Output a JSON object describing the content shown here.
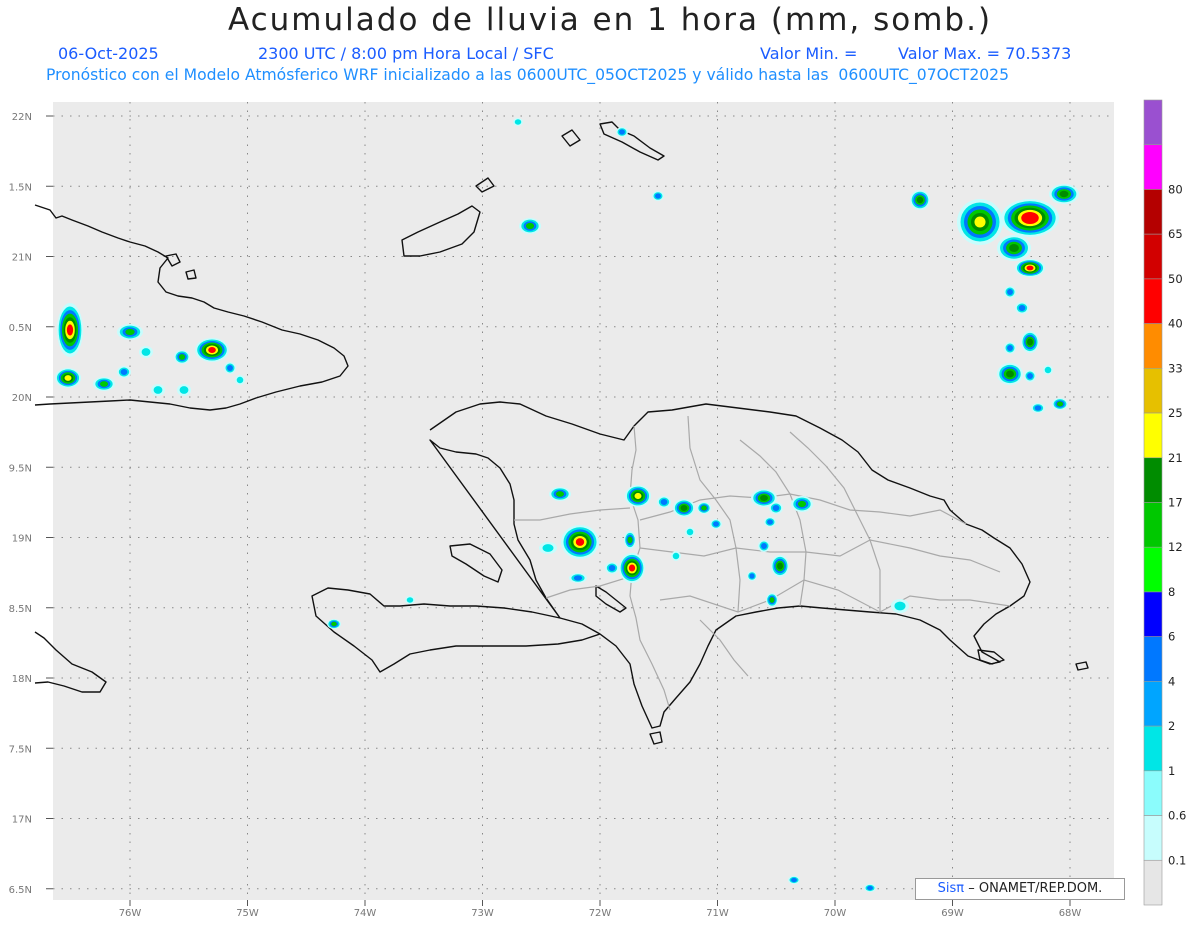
{
  "title": "Acumulado de lluvia en 1 hora (mm, somb.)",
  "subtitle": {
    "date": "06-Oct-2025",
    "time": "2300 UTC / 8:00 pm Hora Local / SFC",
    "min_label": "Valor Min. =",
    "max_label": "Valor Max. = 70.5373",
    "model_line": "Pronóstico con el Modelo Atmósferico WRF inicializado a las 0600UTC_05OCT2025 y válido hasta las  0600UTC_07OCT2025"
  },
  "map": {
    "lat_labels": [
      "22N",
      "1.5N",
      "21N",
      "0.5N",
      "20N",
      "9.5N",
      "19N",
      "8.5N",
      "18N",
      "7.5N",
      "17N",
      "6.5N"
    ],
    "lon_labels": [
      "76W",
      "75W",
      "74W",
      "73W",
      "72W",
      "71W",
      "70W",
      "69W",
      "68W"
    ],
    "colors": {
      "background": "#ebebeb",
      "coast": "#111111",
      "provinces": "#a9a9a9",
      "grid": "#888888"
    }
  },
  "colorbar": {
    "labels": [
      "0.1",
      "0.6",
      "1",
      "2",
      "4",
      "6",
      "8",
      "12",
      "17",
      "21",
      "25",
      "33",
      "40",
      "50",
      "65",
      "80"
    ],
    "colors": [
      "#e6e6e6",
      "#c7fdfd",
      "#8bfcfc",
      "#00e6e6",
      "#00a5ff",
      "#0078ff",
      "#0000ff",
      "#00ff00",
      "#00c800",
      "#008c00",
      "#ffff00",
      "#e6c000",
      "#ff8c00",
      "#ff0000",
      "#d20000",
      "#b40000",
      "#ff00ff",
      "#9a50d0"
    ]
  },
  "credit": {
    "brand": "Sisπ",
    "rest": "– ONAMET/REP.DOM."
  }
}
